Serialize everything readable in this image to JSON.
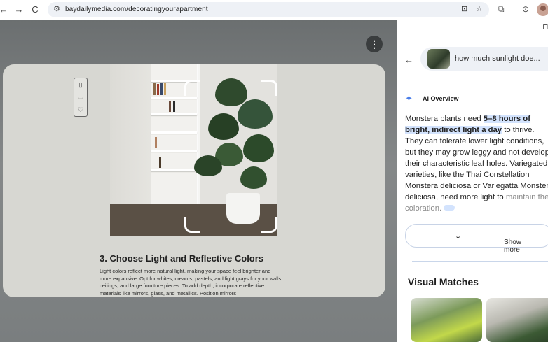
{
  "browser": {
    "url": "baydailymedia.com/decoratingyourapartment",
    "nav_icons": [
      "back-arrow-icon",
      "forward-arrow-icon",
      "reload-icon"
    ],
    "back_glyph": "←",
    "forward_glyph": "→",
    "reload_glyph": "C",
    "site_info_glyph": "⚙",
    "lens_glyph": "⊡",
    "star_glyph": "☆",
    "extensions_glyph": "⧉",
    "lens2_glyph": "⊙"
  },
  "lens_overlay": {
    "more_glyph": "⋮",
    "side_actions": [
      {
        "name": "bookmark-icon",
        "glyph": "▯"
      },
      {
        "name": "comment-icon",
        "glyph": "▭"
      },
      {
        "name": "heart-icon",
        "glyph": "♡"
      }
    ],
    "article": {
      "heading": "3. Choose Light and Reflective Colors",
      "body": "Light colors reflect more natural light, making your space feel brighter and more expansive. Opt for whites, creams, pastels, and light grays for your walls, ceilings, and large furniture pieces. To add depth, incorporate reflective materials like mirrors, glass, and metallics. Position mirrors"
    }
  },
  "side_panel": {
    "pin_glyph": "⊓",
    "back_glyph": "←",
    "query": "how much sunlight doe...",
    "ai_overview_label": "AI Overview",
    "sparkle_glyph": "✦",
    "answer": {
      "pre": "Monstera plants need ",
      "highlight": "5–8 hours of bright, indirect light a day",
      "post": " to thrive. They can tolerate lower light conditions, but they may grow leggy and not develop their characteristic leaf holes. Variegated varieties, like the Thai Constellation Monstera deliciosa or Variegatta Monstera deliciosa, need more light to ",
      "fade": "maintain their coloration."
    },
    "show_more_label": "Show more",
    "chevron_glyph": "⌄",
    "visual_matches_title": "Visual Matches"
  },
  "colors": {
    "accent": "#4a7de8",
    "highlight_bg": "#d3e3fd"
  }
}
